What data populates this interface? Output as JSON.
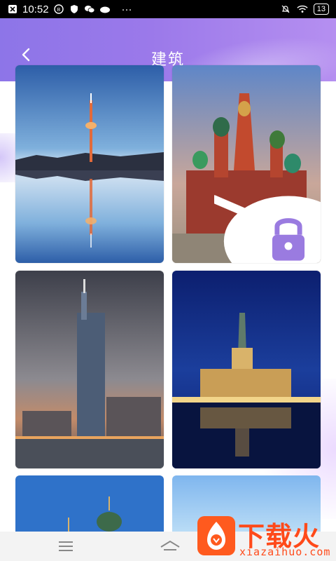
{
  "status_bar": {
    "time": "10:52",
    "battery": "13",
    "more": "···"
  },
  "header": {
    "title": "建筑",
    "back_icon": "chevron-left-icon"
  },
  "grid": {
    "items": [
      {
        "name": "tv-tower-reflection",
        "locked": false
      },
      {
        "name": "st-basils-cathedral",
        "locked": true,
        "lock_icon": "lock-icon"
      },
      {
        "name": "skyscraper-city-dusk",
        "locked": false
      },
      {
        "name": "hamburg-city-hall-night",
        "locked": false
      },
      {
        "name": "onion-dome-partial",
        "locked": false
      },
      {
        "name": "blue-sky-partial",
        "locked": false
      }
    ]
  },
  "nav": {
    "menu_icon": "menu-icon",
    "home_icon": "home-icon"
  },
  "watermark": {
    "title": "下载火",
    "domain": "xiazaihuo.com"
  },
  "colors": {
    "header_start": "#8d75e8",
    "header_end": "#b58ff0",
    "watermark": "#ff4a1a"
  }
}
